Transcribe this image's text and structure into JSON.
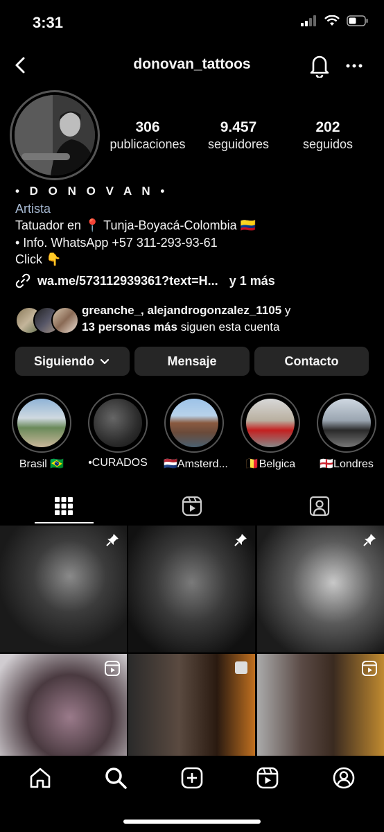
{
  "status_bar": {
    "time": "3:31"
  },
  "header": {
    "username": "donovan_tattoos"
  },
  "stats": [
    {
      "value": "306",
      "label": "publicaciones"
    },
    {
      "value": "9.457",
      "label": "seguidores"
    },
    {
      "value": "202",
      "label": "seguidos"
    }
  ],
  "bio": {
    "name": "• D O N O V A N •",
    "category": "Artista",
    "lines": [
      "Tatuador en 📍 Tunja-Boyacá-Colombia 🇨🇴",
      "• Info. WhatsApp +57 311-293-93-61",
      "Click 👇"
    ],
    "link_text": "wa.me/573112939361?text=H...",
    "link_more": "y 1 más"
  },
  "followed_by": {
    "names": "greanche_, alejandrogonzalez_1105",
    "conj": " y",
    "count_text": "13 personas más",
    "suffix": " siguen esta cuenta"
  },
  "buttons": {
    "following": "Siguiendo",
    "message": "Mensaje",
    "contact": "Contacto"
  },
  "highlights": [
    {
      "label": "Brasil 🇧🇷"
    },
    {
      "label": "•CURADOS"
    },
    {
      "label": "🇳🇱Amsterd..."
    },
    {
      "label": "🇧🇪Belgica"
    },
    {
      "label": "🏴󠁧󠁢󠁥󠁮󠁧󠁿Londres"
    }
  ],
  "grid": [
    {
      "badge": "pin-icon"
    },
    {
      "badge": "pin-icon"
    },
    {
      "badge": "pin-icon"
    },
    {
      "badge": "reel-icon"
    },
    {
      "badge": "multi-icon"
    },
    {
      "badge": "reel-icon"
    }
  ]
}
